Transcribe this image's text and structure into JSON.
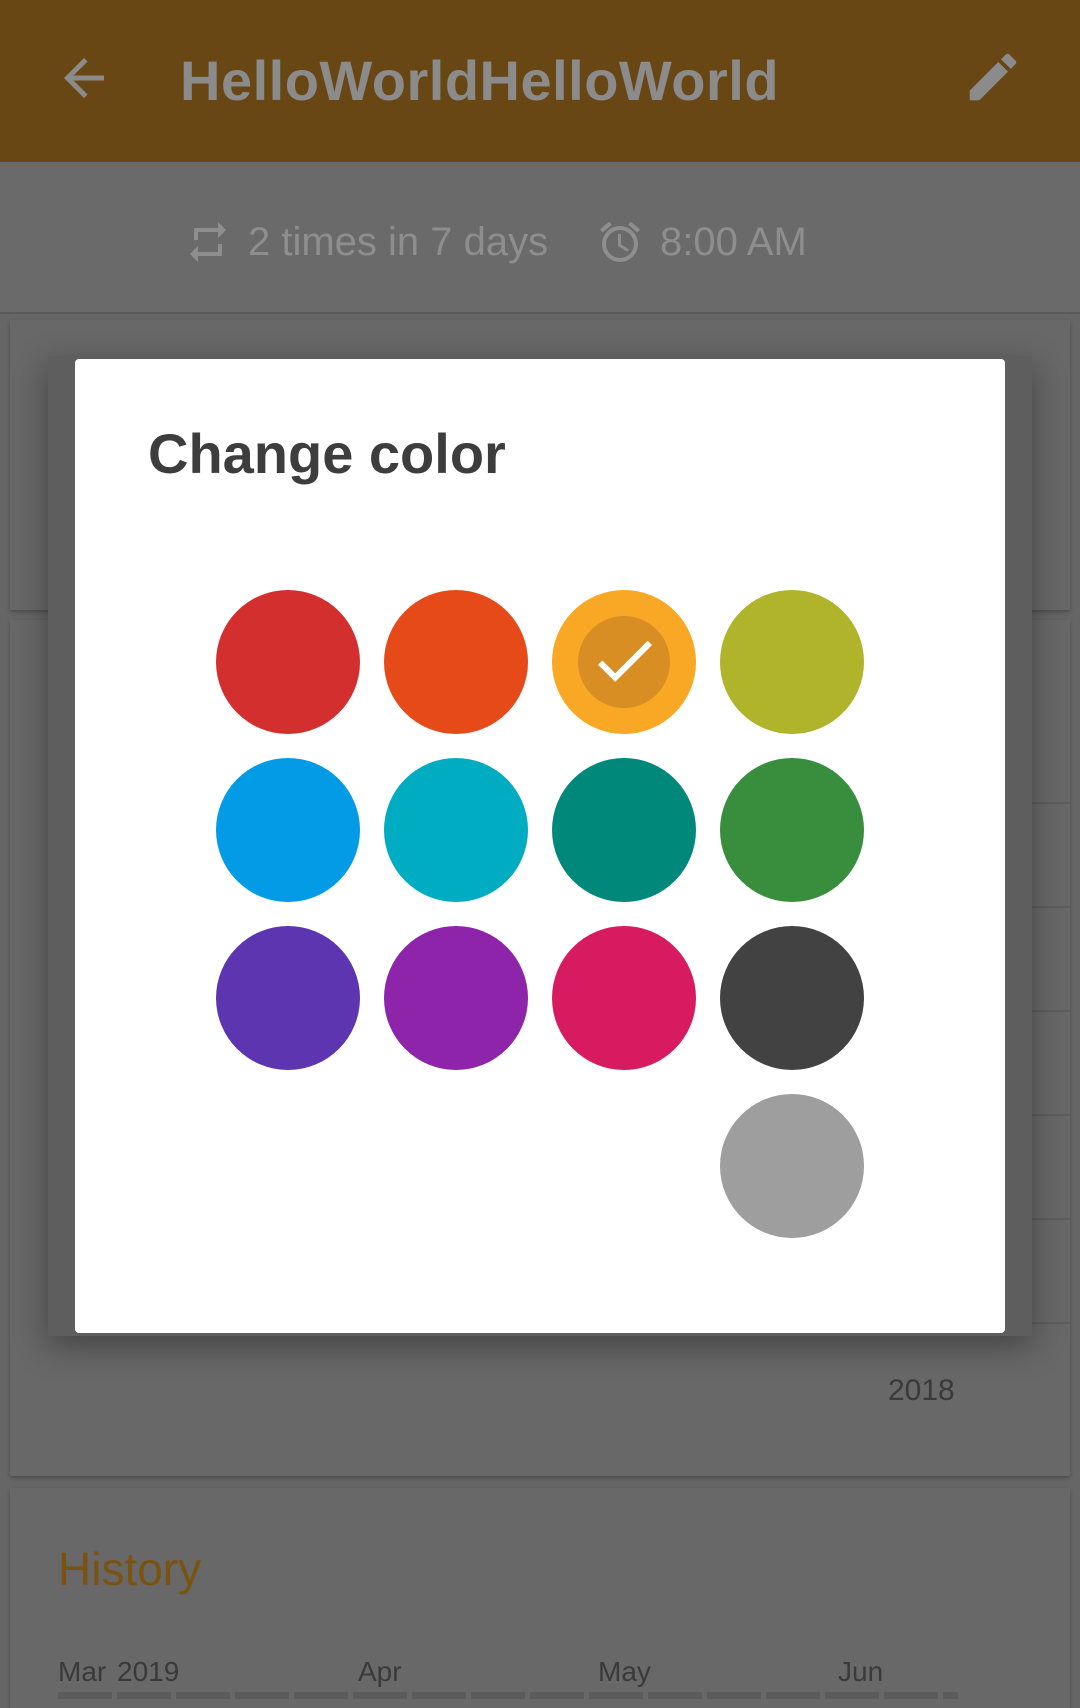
{
  "appbar": {
    "title": "HelloWorldHelloWorld",
    "color": "#684714"
  },
  "subheader": {
    "frequency": "2 times in 7 days",
    "reminder": "8:00 AM"
  },
  "chart": {
    "year_label": "2018"
  },
  "history": {
    "title": "History",
    "months": [
      "Mar",
      "2019",
      "Apr",
      "May",
      "Jun"
    ]
  },
  "dialog": {
    "title": "Change color",
    "selected_index": 2,
    "swatches": [
      {
        "color": "#D32F2F"
      },
      {
        "color": "#E64A19"
      },
      {
        "color": "#F9A825"
      },
      {
        "color": "#AFB42B"
      },
      {
        "color": "#039BE5"
      },
      {
        "color": "#00ACC1"
      },
      {
        "color": "#00897B"
      },
      {
        "color": "#388E3C"
      },
      {
        "color": "#5E35B1"
      },
      {
        "color": "#8E24AA"
      },
      {
        "color": "#D81B60"
      },
      {
        "color": "#424242"
      },
      {
        "color": "#9E9E9E"
      }
    ]
  }
}
